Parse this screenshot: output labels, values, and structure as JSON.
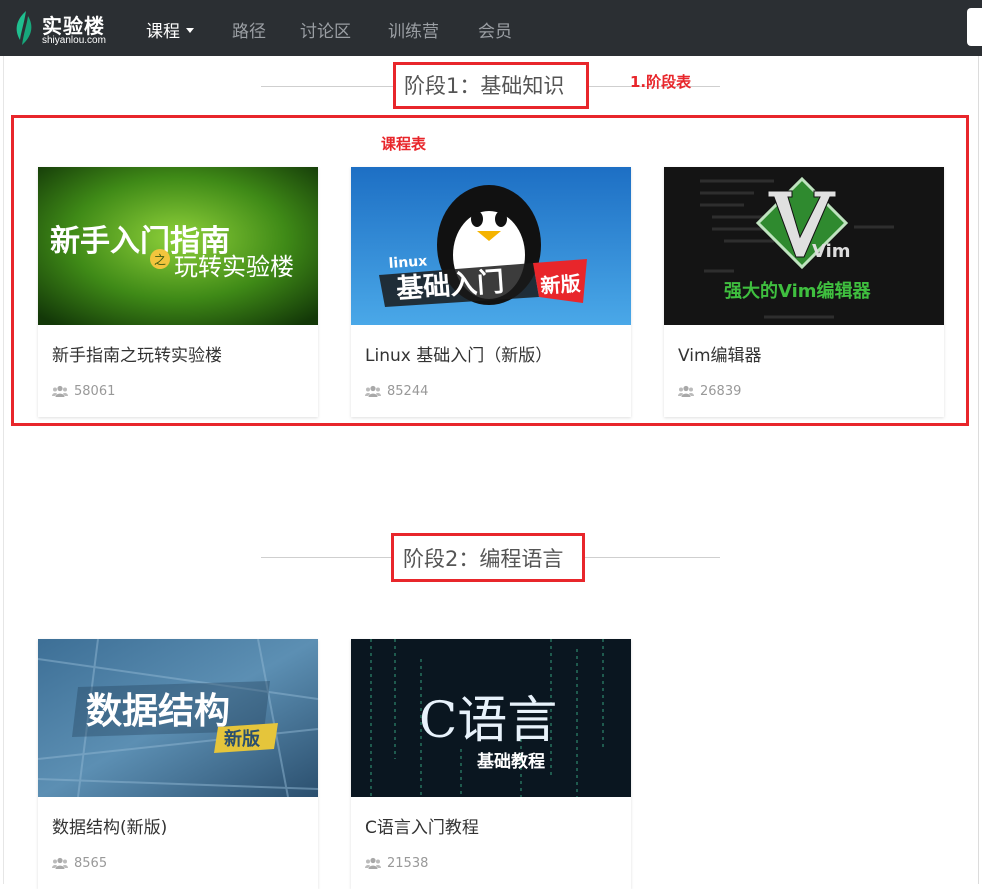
{
  "navbar": {
    "logo_title": "实验楼",
    "logo_sub": "shiyanlou.com",
    "items": [
      {
        "label": "课程",
        "active": true
      },
      {
        "label": "路径"
      },
      {
        "label": "讨论区"
      },
      {
        "label": "训练营"
      },
      {
        "label": "会员"
      }
    ]
  },
  "annotations": {
    "stage_table": "1.阶段表",
    "course_table": "课程表"
  },
  "stages": [
    {
      "title": "阶段1：基础知识",
      "courses": [
        {
          "title": "新手指南之玩转实验楼",
          "users": "58061",
          "image_main": "新手入门指南",
          "image_sub": "玩转实验楼",
          "image_small": "之"
        },
        {
          "title": "Linux 基础入门（新版）",
          "users": "85244",
          "image_tag": "linux",
          "image_main": "基础入门",
          "image_badge": "新版"
        },
        {
          "title": "Vim编辑器",
          "users": "26839",
          "image_logo": "Vim",
          "image_main": "强大的Vim编辑器"
        }
      ]
    },
    {
      "title": "阶段2：编程语言",
      "courses": [
        {
          "title": "数据结构(新版)",
          "users": "8565",
          "image_main": "数据结构",
          "image_badge": "新版"
        },
        {
          "title": "C语言入门教程",
          "users": "21538",
          "image_main": "C语言",
          "image_sub": "基础教程"
        }
      ]
    }
  ]
}
